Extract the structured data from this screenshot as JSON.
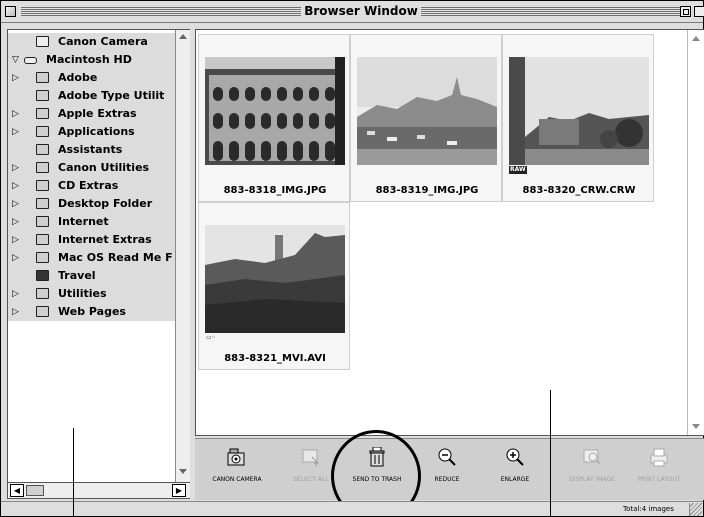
{
  "window": {
    "title": "Browser Window"
  },
  "tree": {
    "items": [
      {
        "label": "Canon Camera",
        "expand": "",
        "icon": "camera-icon",
        "level": 1
      },
      {
        "label": "Macintosh HD",
        "expand": "▽",
        "icon": "hard-disk-icon",
        "level": 0
      },
      {
        "label": "Adobe",
        "expand": "▷",
        "icon": "folder-icon",
        "level": 1
      },
      {
        "label": "Adobe Type Utilit",
        "expand": "",
        "icon": "folder-icon",
        "level": 1
      },
      {
        "label": "Apple Extras",
        "expand": "▷",
        "icon": "folder-icon",
        "level": 1
      },
      {
        "label": "Applications",
        "expand": "▷",
        "icon": "folder-icon",
        "level": 1
      },
      {
        "label": "Assistants",
        "expand": "",
        "icon": "folder-icon",
        "level": 1
      },
      {
        "label": "Canon Utilities",
        "expand": "▷",
        "icon": "folder-icon",
        "level": 1
      },
      {
        "label": "CD Extras",
        "expand": "▷",
        "icon": "folder-icon",
        "level": 1
      },
      {
        "label": "Desktop Folder",
        "expand": "▷",
        "icon": "folder-icon",
        "level": 1
      },
      {
        "label": "Internet",
        "expand": "▷",
        "icon": "folder-icon",
        "level": 1
      },
      {
        "label": "Internet Extras",
        "expand": "▷",
        "icon": "folder-icon",
        "level": 1
      },
      {
        "label": "Mac OS Read Me F",
        "expand": "▷",
        "icon": "folder-icon",
        "level": 1
      },
      {
        "label": "Travel",
        "expand": "",
        "icon": "folder-open-icon",
        "level": 1
      },
      {
        "label": "Utilities",
        "expand": "▷",
        "icon": "folder-icon",
        "level": 1
      },
      {
        "label": "Web Pages",
        "expand": "▷",
        "icon": "folder-icon",
        "level": 1
      }
    ]
  },
  "thumbnails": [
    {
      "filename": "883-8318_IMG.JPG",
      "badge": ""
    },
    {
      "filename": "883-8319_IMG.JPG",
      "badge": ""
    },
    {
      "filename": "883-8320_CRW.CRW",
      "badge": "RAW"
    },
    {
      "filename": "883-8321_MVI.AVI",
      "badge": "movie-icon"
    }
  ],
  "toolbar": {
    "canon_camera": {
      "label": "CANON CAMERA",
      "icon": "canon-camera-icon",
      "enabled": true
    },
    "select_all": {
      "label": "SELECT ALL",
      "icon": "select-all-icon",
      "enabled": false
    },
    "send_to_trash": {
      "label": "SEND TO TRASH",
      "icon": "trash-icon",
      "enabled": true
    },
    "reduce": {
      "label": "REDUCE",
      "icon": "zoom-out-icon",
      "enabled": true
    },
    "enlarge": {
      "label": "ENLARGE",
      "icon": "zoom-in-icon",
      "enabled": true
    },
    "display_image": {
      "label": "DISPLAY IMAGE",
      "icon": "display-image-icon",
      "enabled": false
    },
    "print_layout": {
      "label": "PRINT LAYOUT",
      "icon": "print-layout-icon",
      "enabled": false
    }
  },
  "status": {
    "total": "Total:4 images"
  }
}
